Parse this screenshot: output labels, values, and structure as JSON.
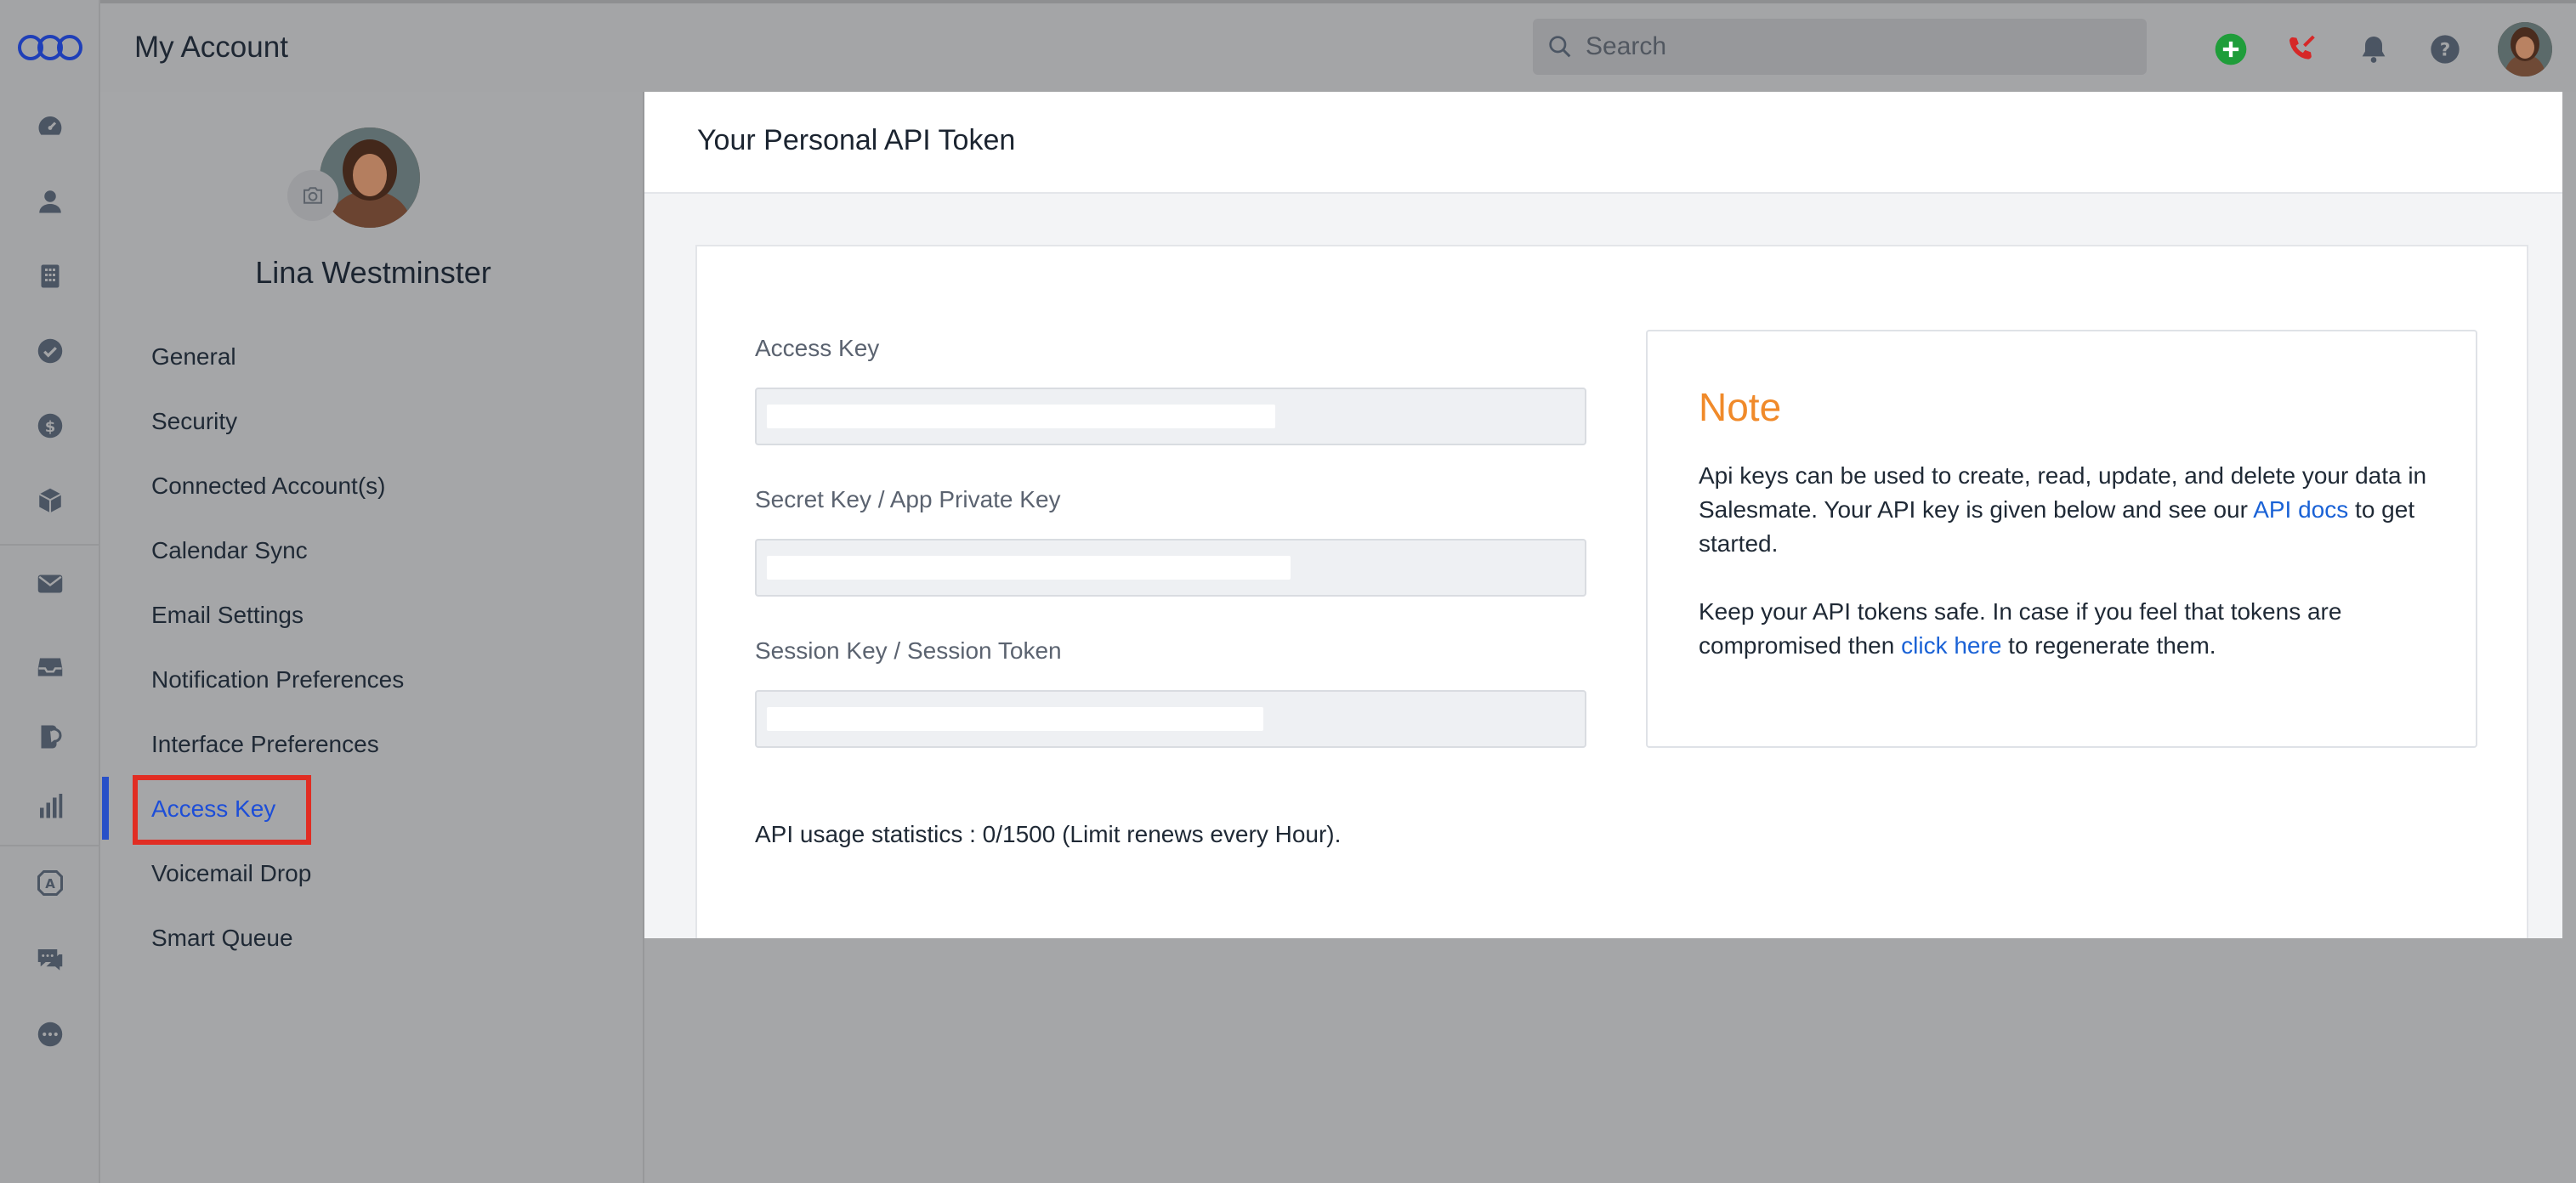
{
  "topbar": {
    "title": "My Account",
    "search_placeholder": "Search"
  },
  "icons": {
    "rail": [
      "dashboard-icon",
      "contacts-icon",
      "companies-icon",
      "tasks-icon",
      "deals-icon",
      "products-icon",
      "email-icon",
      "inbox-icon",
      "conversations-icon",
      "reports-icon",
      "automation-icon",
      "chat-icon",
      "more-icon"
    ],
    "topbar": [
      "search-icon",
      "add-icon",
      "missed-call-icon",
      "bell-icon",
      "help-icon"
    ]
  },
  "colors": {
    "accent": "#1d4ed8",
    "note_title": "#f08a2a",
    "highlight": "#e12d23",
    "add_icon": "#1f9d3a",
    "call_icon": "#d62828"
  },
  "sidebar": {
    "user_name": "Lina Westminster",
    "items": [
      {
        "label": "General"
      },
      {
        "label": "Security"
      },
      {
        "label": "Connected Account(s)"
      },
      {
        "label": "Calendar Sync"
      },
      {
        "label": "Email Settings"
      },
      {
        "label": "Notification Preferences"
      },
      {
        "label": "Interface Preferences"
      },
      {
        "label": "Access Key",
        "active": true
      },
      {
        "label": "Voicemail Drop"
      },
      {
        "label": "Smart Queue"
      }
    ]
  },
  "main": {
    "heading": "Your Personal API Token",
    "fields": [
      {
        "label": "Access Key",
        "value": ""
      },
      {
        "label": "Secret Key / App Private Key",
        "value": ""
      },
      {
        "label": "Session Key / Session Token",
        "value": ""
      }
    ],
    "usage": "API usage statistics : 0/1500 (Limit renews every Hour).",
    "note": {
      "title": "Note",
      "p1_text": "Api keys can be used to create, read, update, and delete your data in Salesmate. Your API key is given below and see our",
      "p1_link": "API docs",
      "p1_after": "to get started.",
      "p2_text": "Keep your API tokens safe. In case if you feel that tokens are compromised then",
      "p2_link": "click here",
      "p2_after": "to regenerate them."
    }
  }
}
